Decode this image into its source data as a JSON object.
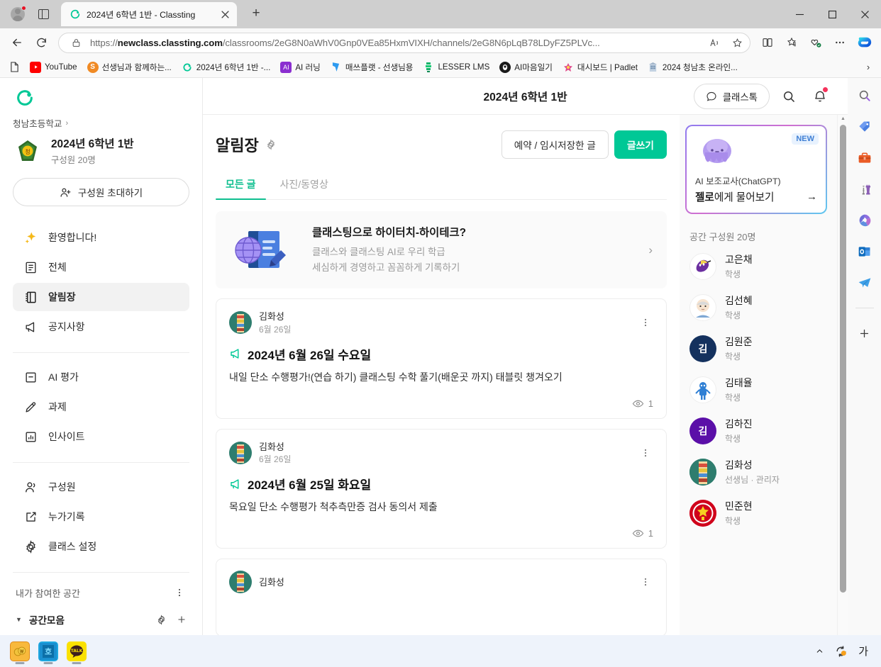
{
  "browser": {
    "tab": {
      "title": "2024년 6학년 1반 - Classting",
      "favicon": "classting-icon"
    },
    "newtab_label": "+",
    "window": {
      "minimize": "—",
      "maximize": "□",
      "close": "✕"
    },
    "url": {
      "prefix": "https://",
      "domain": "newclass.classting.com",
      "path": "/classrooms/2eG8N0aWhV0Gnp0VEa85HxmVIXH/channels/2eG8N6pLqB78LDyFZ5PLVc..."
    },
    "bookmarks": [
      {
        "label": "",
        "icon": "page-icon",
        "color": "#ffffff"
      },
      {
        "label": "YouTube",
        "icon": "youtube-icon",
        "color": "#ff0000"
      },
      {
        "label": "선생님과 함께하는...",
        "icon": "skype-icon",
        "color": "#f08a24"
      },
      {
        "label": "2024년 6학년 1반 -...",
        "icon": "classting-icon",
        "color": "#00c896"
      },
      {
        "label": "AI 러닝",
        "icon": "ai-icon",
        "color": "#8b2fd0"
      },
      {
        "label": "매쓰플랫 - 선생님용",
        "icon": "mathflat-icon",
        "color": "#2e9bf0"
      },
      {
        "label": "LESSER LMS",
        "icon": "lesser-icon",
        "color": "#16b36a"
      },
      {
        "label": "AI마음일기",
        "icon": "aidiary-icon",
        "color": "#1a1a1a"
      },
      {
        "label": "대시보드 | Padlet",
        "icon": "padlet-icon",
        "color": "#e14b8a"
      },
      {
        "label": "2024 청남초 온라인...",
        "icon": "building-icon",
        "color": "#b5c4d6"
      }
    ],
    "bookmarks_overflow": "›"
  },
  "sidebar_left": {
    "logo": "classting-logo",
    "school": "청남초등학교",
    "class_name": "2024년 6학년 1반",
    "member_count": "구성원 20명",
    "invite_label": "구성원 초대하기",
    "nav_primary": [
      {
        "label": "환영합니다!",
        "icon": "sparkle-icon",
        "active": false
      },
      {
        "label": "전체",
        "icon": "list-icon",
        "active": false
      },
      {
        "label": "알림장",
        "icon": "notebook-icon",
        "active": true
      },
      {
        "label": "공지사항",
        "icon": "megaphone-icon",
        "active": false
      }
    ],
    "nav_secondary": [
      {
        "label": "AI 평가",
        "icon": "assessment-icon"
      },
      {
        "label": "과제",
        "icon": "pencil-icon"
      },
      {
        "label": "인사이트",
        "icon": "chart-icon"
      }
    ],
    "nav_tertiary": [
      {
        "label": "구성원",
        "icon": "people-icon"
      },
      {
        "label": "누가기록",
        "icon": "record-icon"
      },
      {
        "label": "클래스 설정",
        "icon": "gear-icon"
      }
    ],
    "my_spaces_label": "내가 참여한 공간",
    "group_label": "공간모음"
  },
  "main": {
    "header_title": "2024년 6학년 1반",
    "classtalk_label": "클래스톡",
    "page_title": "알림장",
    "btn_draft": "예약 / 임시저장한 글",
    "btn_write": "글쓰기",
    "tabs": [
      {
        "label": "모든 글",
        "active": true
      },
      {
        "label": "사진/동영상",
        "active": false
      }
    ],
    "banner": {
      "heading": "클래스팅으로 하이터치-하이테크?",
      "line1": "클래스와 클래스팅 AI로 우리 학급",
      "line2": "세심하게 경영하고 꼼꼼하게 기록하기",
      "arrow": "›"
    },
    "posts": [
      {
        "author": "김화성",
        "date": "6월 26일",
        "title": "2024년 6월 26일 수요일",
        "body": "내일 단소 수행평가!(연습 하기) 클래스팅 수학 풀기(배운곳 까지) 태블릿 챙겨오기",
        "views": "1"
      },
      {
        "author": "김화성",
        "date": "6월 26일",
        "title": "2024년 6월 25일 화요일",
        "body": "목요일 단소 수행평가 척추측만증 검사 동의서 제출",
        "views": "1"
      },
      {
        "author": "김화성",
        "date": "",
        "title": "",
        "body": "",
        "views": ""
      }
    ]
  },
  "sidebar_right": {
    "ai_card": {
      "badge": "NEW",
      "line1": "AI 보조교사(ChatGPT)",
      "line2_bold": "젤로",
      "line2_rest": "에게 물어보기",
      "arrow": "→",
      "avatar": "jello-mascot-icon"
    },
    "members_header": "공간 구성원 20명",
    "members": [
      {
        "name": "고은채",
        "role": "학생",
        "avatar_type": "image",
        "avatar_color": "#ffffff",
        "initial": ""
      },
      {
        "name": "김선혜",
        "role": "학생",
        "avatar_type": "image",
        "avatar_color": "#ffffff",
        "initial": ""
      },
      {
        "name": "김원준",
        "role": "학생",
        "avatar_type": "initial",
        "avatar_color": "#14315e",
        "initial": "김"
      },
      {
        "name": "김태율",
        "role": "학생",
        "avatar_type": "image",
        "avatar_color": "#ffffff",
        "initial": ""
      },
      {
        "name": "김하진",
        "role": "학생",
        "avatar_type": "initial",
        "avatar_color": "#5b0fa8",
        "initial": "김"
      },
      {
        "name": "김화성",
        "role": "선생님 · 관리자",
        "avatar_type": "image",
        "avatar_color": "#2e7d6e",
        "initial": ""
      },
      {
        "name": "민준현",
        "role": "학생",
        "avatar_type": "image",
        "avatar_color": "#d0021b",
        "initial": ""
      }
    ]
  },
  "edge_sidebar": [
    {
      "name": "search-icon"
    },
    {
      "name": "shopping-tag-icon"
    },
    {
      "name": "tools-icon"
    },
    {
      "name": "games-icon"
    },
    {
      "name": "microsoft365-icon"
    },
    {
      "name": "outlook-icon"
    },
    {
      "name": "telegram-icon"
    },
    {
      "name": "add-icon"
    }
  ],
  "taskbar": {
    "apps": [
      {
        "name": "kakao-pay-icon",
        "color": "#f8b93c"
      },
      {
        "name": "hancom-icon",
        "color": "#1ea8e0"
      },
      {
        "name": "kakaotalk-icon",
        "color": "#fae100",
        "label": "TALK"
      }
    ],
    "tray": {
      "chevron": "⌃",
      "sync": "sync-icon",
      "ime": "가"
    }
  },
  "colors": {
    "brand_green": "#00c896",
    "accent_green": "#0fbf8f",
    "notification_red": "#f5325b"
  }
}
